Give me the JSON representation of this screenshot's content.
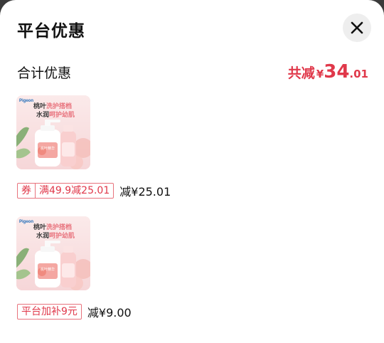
{
  "sheet": {
    "title": "平台优惠",
    "close_icon": "close-icon"
  },
  "total": {
    "label": "合计优惠",
    "prefix": "共减",
    "currency": "¥",
    "amount_int": "34",
    "amount_dec": ".01",
    "color": "#e0384a"
  },
  "items": [
    {
      "image": {
        "brand": "Pigeon",
        "headline_1a": "桃叶",
        "headline_1b": "洗护搭档",
        "headline_2a": "水润",
        "headline_2b": "呵护幼肌",
        "badge": "桃叶精华"
      },
      "tag_parts": [
        "券",
        "满49.9减25.01"
      ],
      "deduction": "减¥25.01"
    },
    {
      "image": {
        "brand": "Pigeon",
        "headline_1a": "桃叶",
        "headline_1b": "洗护搭档",
        "headline_2a": "水润",
        "headline_2b": "呵护幼肌",
        "badge": "桃叶精华"
      },
      "tag_parts": [
        "平台加补9元"
      ],
      "deduction": "减¥9.00"
    }
  ]
}
